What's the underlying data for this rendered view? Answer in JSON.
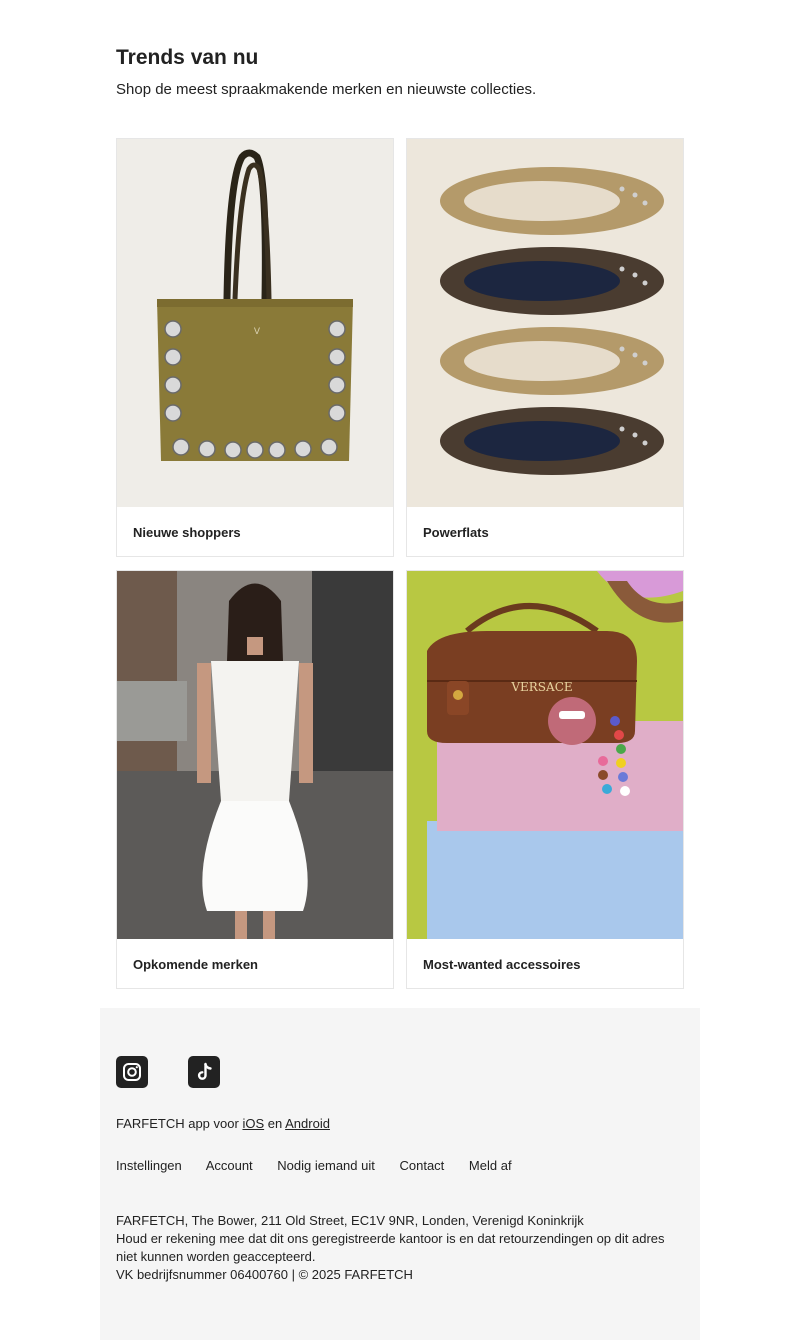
{
  "trends": {
    "title": "Trends van nu",
    "subtitle": "Shop de meest spraakmakende merken en nieuwste collecties."
  },
  "cards": [
    {
      "label": "Nieuwe shoppers",
      "image": "olive suede studded tote bag"
    },
    {
      "label": "Powerflats",
      "image": "studded suede ballet flats"
    },
    {
      "label": "Opkomende merken",
      "image": "model in white dress on street"
    },
    {
      "label": "Most-wanted accessoires",
      "image": "brown Versace bag on boxes"
    }
  ],
  "footer": {
    "social": [
      {
        "icon": "instagram-icon"
      },
      {
        "icon": "tiktok-icon"
      }
    ],
    "app_prefix": "FARFETCH app voor",
    "ios_link": "iOS",
    "app_and": "en",
    "android_link": "Android",
    "links": [
      "Instellingen",
      "Account",
      "Nodig iemand uit",
      "Contact",
      "Meld af"
    ],
    "address_line": "FARFETCH, The Bower, 211 Old Street, EC1V 9NR, Londen, Verenigd Koninkrijk",
    "returns_note": "Houd er rekening mee dat dit ons geregistreerde kantoor is en dat retourzendingen op dit adres niet kunnen worden geaccepteerd.",
    "company_line": "VK bedrijfsnummer 06400760 | © 2025 FARFETCH"
  },
  "colors": {
    "text": "#222222",
    "card_border": "#e6e6e6",
    "footer_bg": "#f5f5f5",
    "icon_bg": "#222222"
  }
}
